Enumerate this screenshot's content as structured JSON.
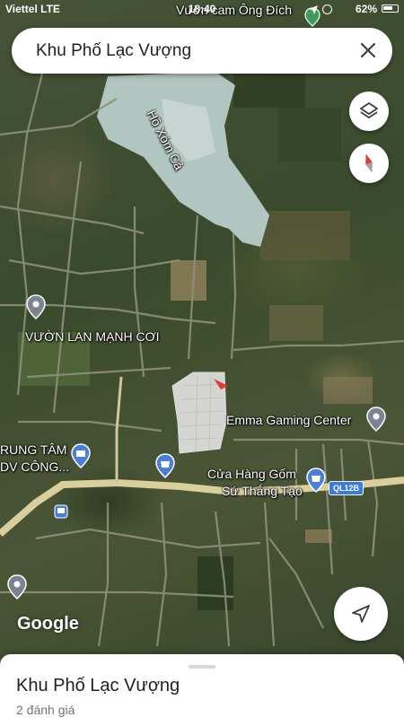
{
  "status_bar": {
    "carrier": "Viettel  LTE",
    "time": "18:40",
    "battery": "62%"
  },
  "search": {
    "query": "Khu Phố Lạc Vượng"
  },
  "map": {
    "type": "satellite",
    "labels": {
      "lake": "Hồ Xóm Cả",
      "orchard": "Vườn cam Ông Đích",
      "vuon_lan": "VƯỜN LAN MẠNH CƠI",
      "emma": "Emma Gaming Center",
      "trung_tam_1": "RUNG TÂM",
      "trung_tam_2": "DV CÔNG...",
      "cua_hang_1": "Cửa Hàng Gốm",
      "cua_hang_2": "Sứ Thắng Tạo",
      "route": "QL12B"
    },
    "attribution": "Google",
    "colors": {
      "highlight_area": "#e8e8e8",
      "road": "#d9cf9c",
      "lake": "#b8ccc9",
      "pin_blue": "#4a7fd8",
      "pin_gray": "#7a8591"
    }
  },
  "controls": {
    "layers": "layers-icon",
    "compass": "compass-icon",
    "my_location": "navigation-arrow-icon",
    "close": "close-icon"
  },
  "place_sheet": {
    "name": "Khu Phố Lạc Vượng",
    "reviews": "2 đánh giá"
  }
}
